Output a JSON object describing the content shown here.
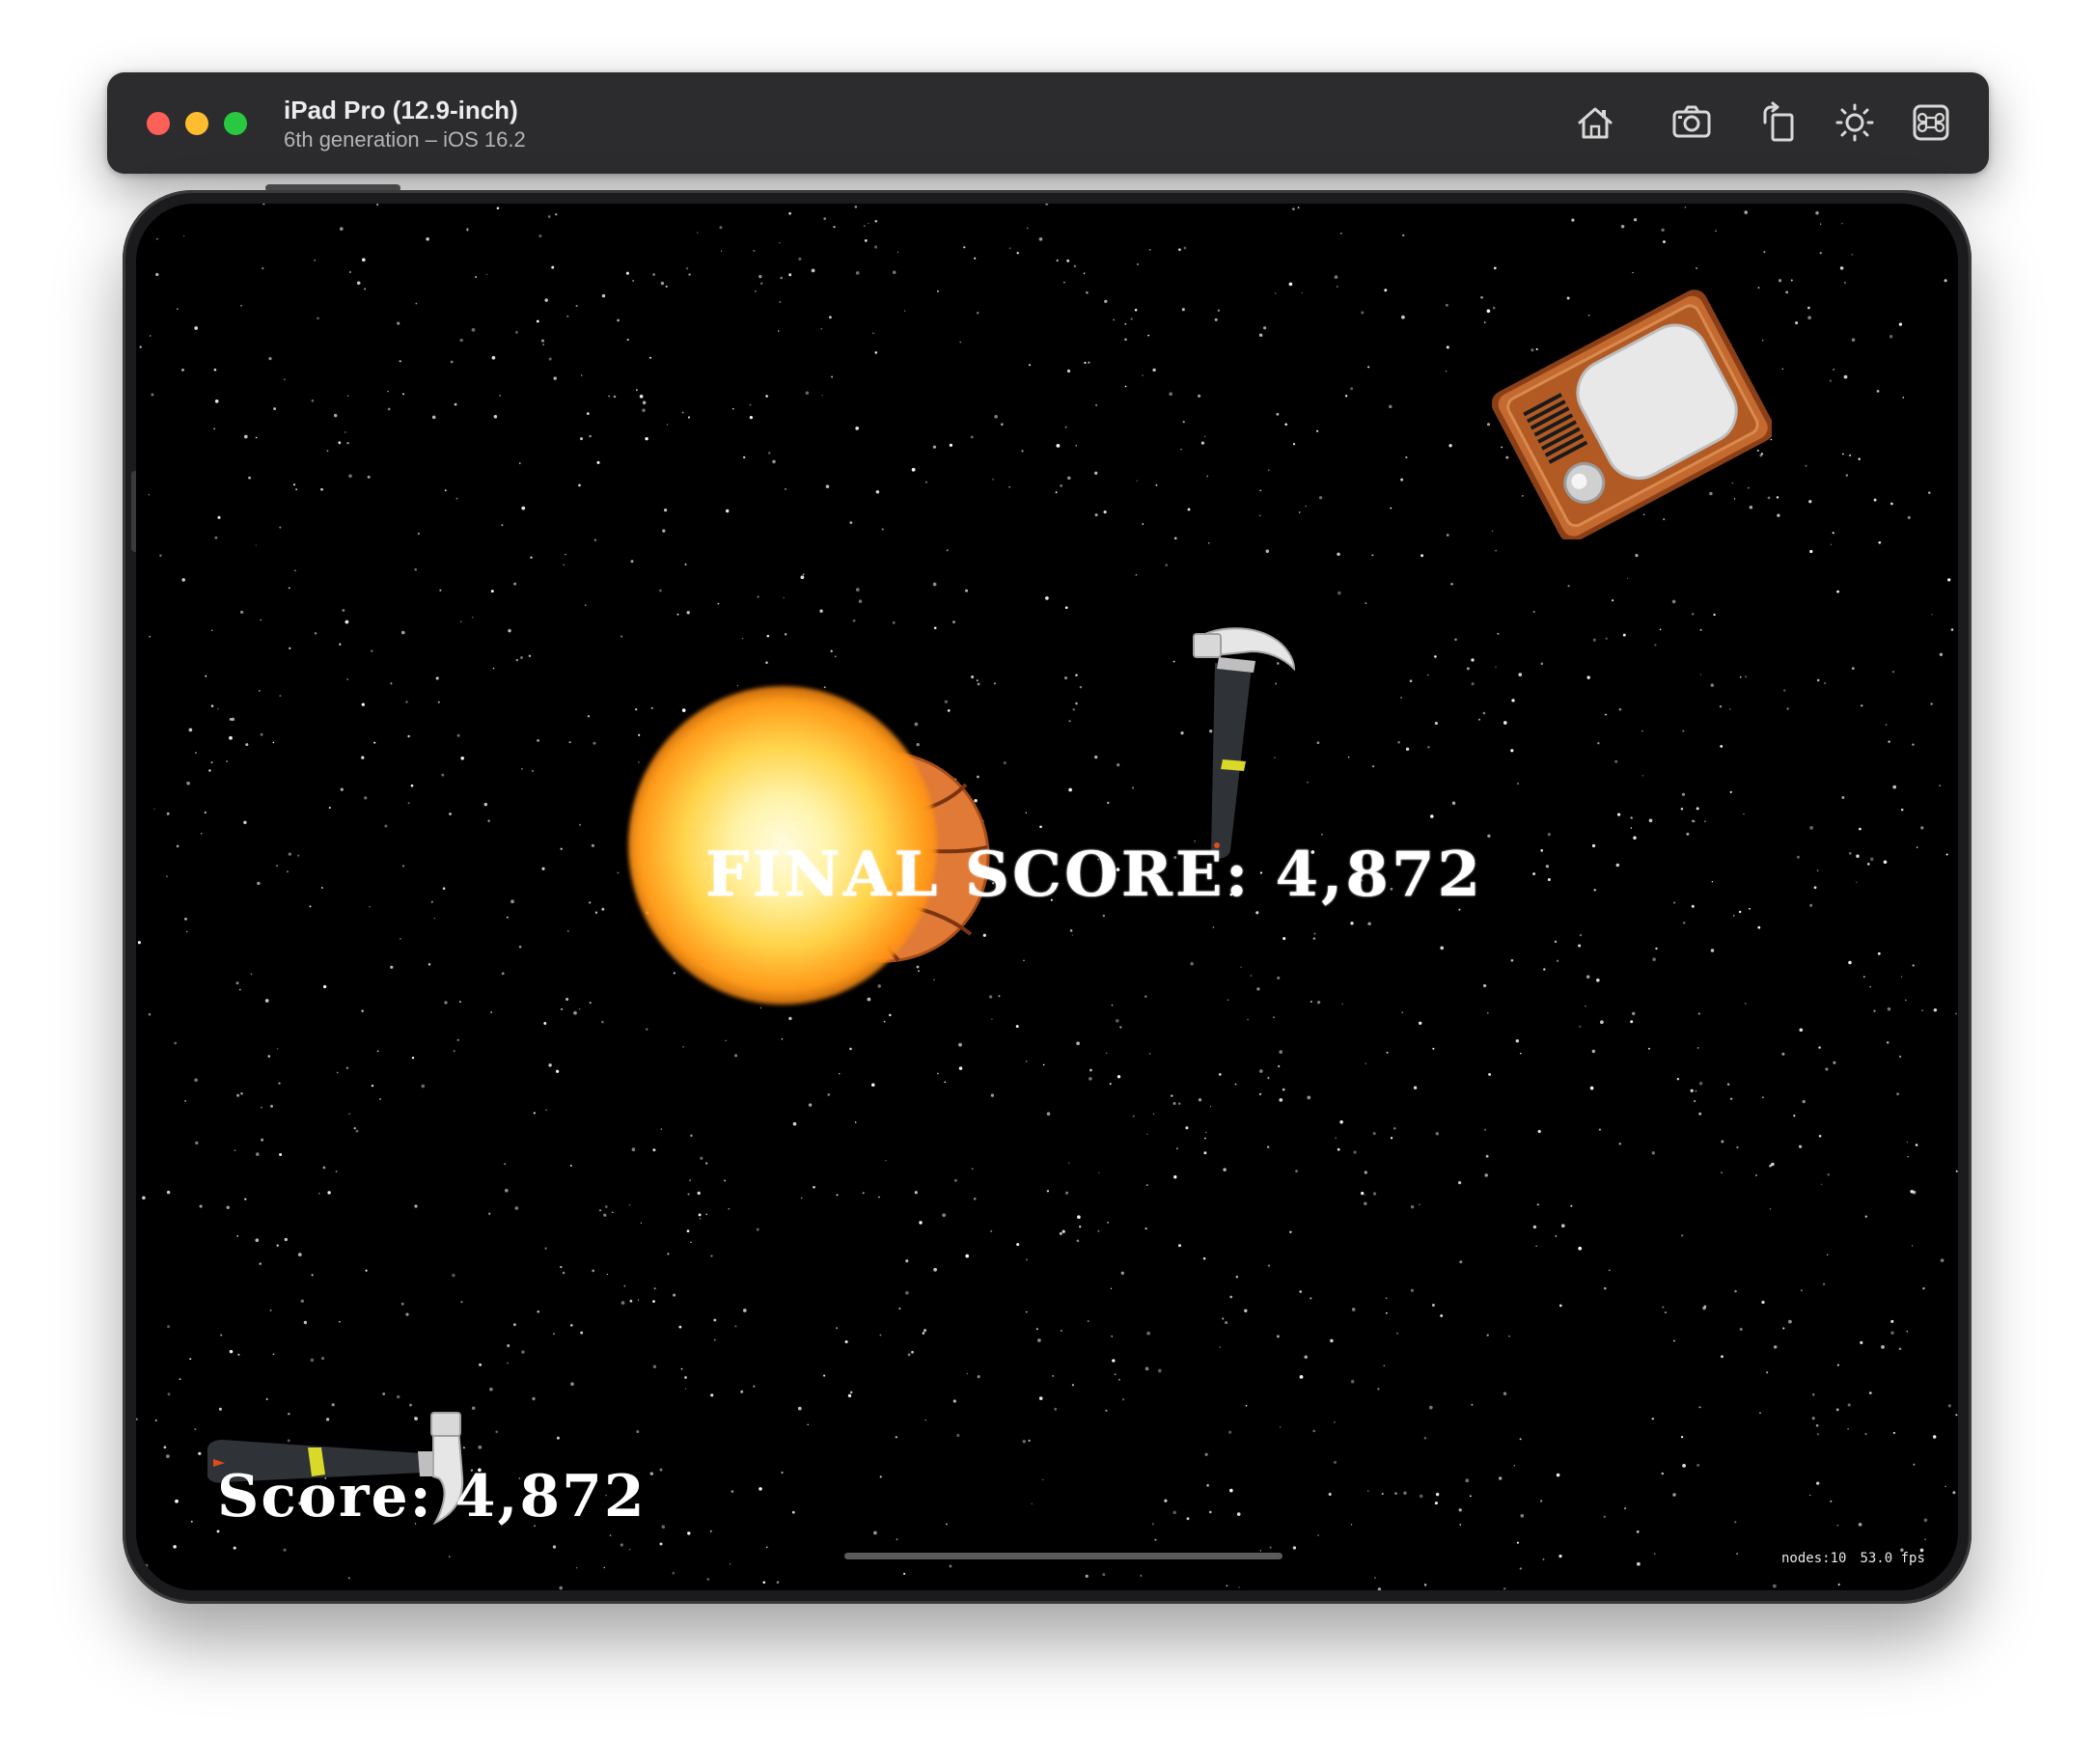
{
  "simulator": {
    "device_name": "iPad Pro (12.9-inch)",
    "device_subtitle": "6th generation – iOS 16.2",
    "toolbar": [
      {
        "name": "home-button",
        "icon": "home-icon"
      },
      {
        "name": "screenshot-button",
        "icon": "camera-icon"
      },
      {
        "name": "rotate-button",
        "icon": "rotate-icon"
      },
      {
        "name": "appearance-button",
        "icon": "brightness-icon"
      },
      {
        "name": "keyboard-button",
        "icon": "command-icon"
      }
    ]
  },
  "game": {
    "final_score_label": "FINAL SCORE: 4,872",
    "score_label": "Score: 4,872",
    "debug": {
      "nodes": "nodes:10",
      "fps": "53.0 fps"
    },
    "sprites": [
      "tv-sprite",
      "hammer-sprite",
      "basketball-sprite",
      "explosion-sprite",
      "player-hammer-sprite"
    ]
  },
  "colors": {
    "titlebar": "#2c2c2e",
    "screen": "#000000",
    "tv_body": "#b5612a",
    "ball": "#e07a36",
    "explosion": "#ffd44a"
  }
}
